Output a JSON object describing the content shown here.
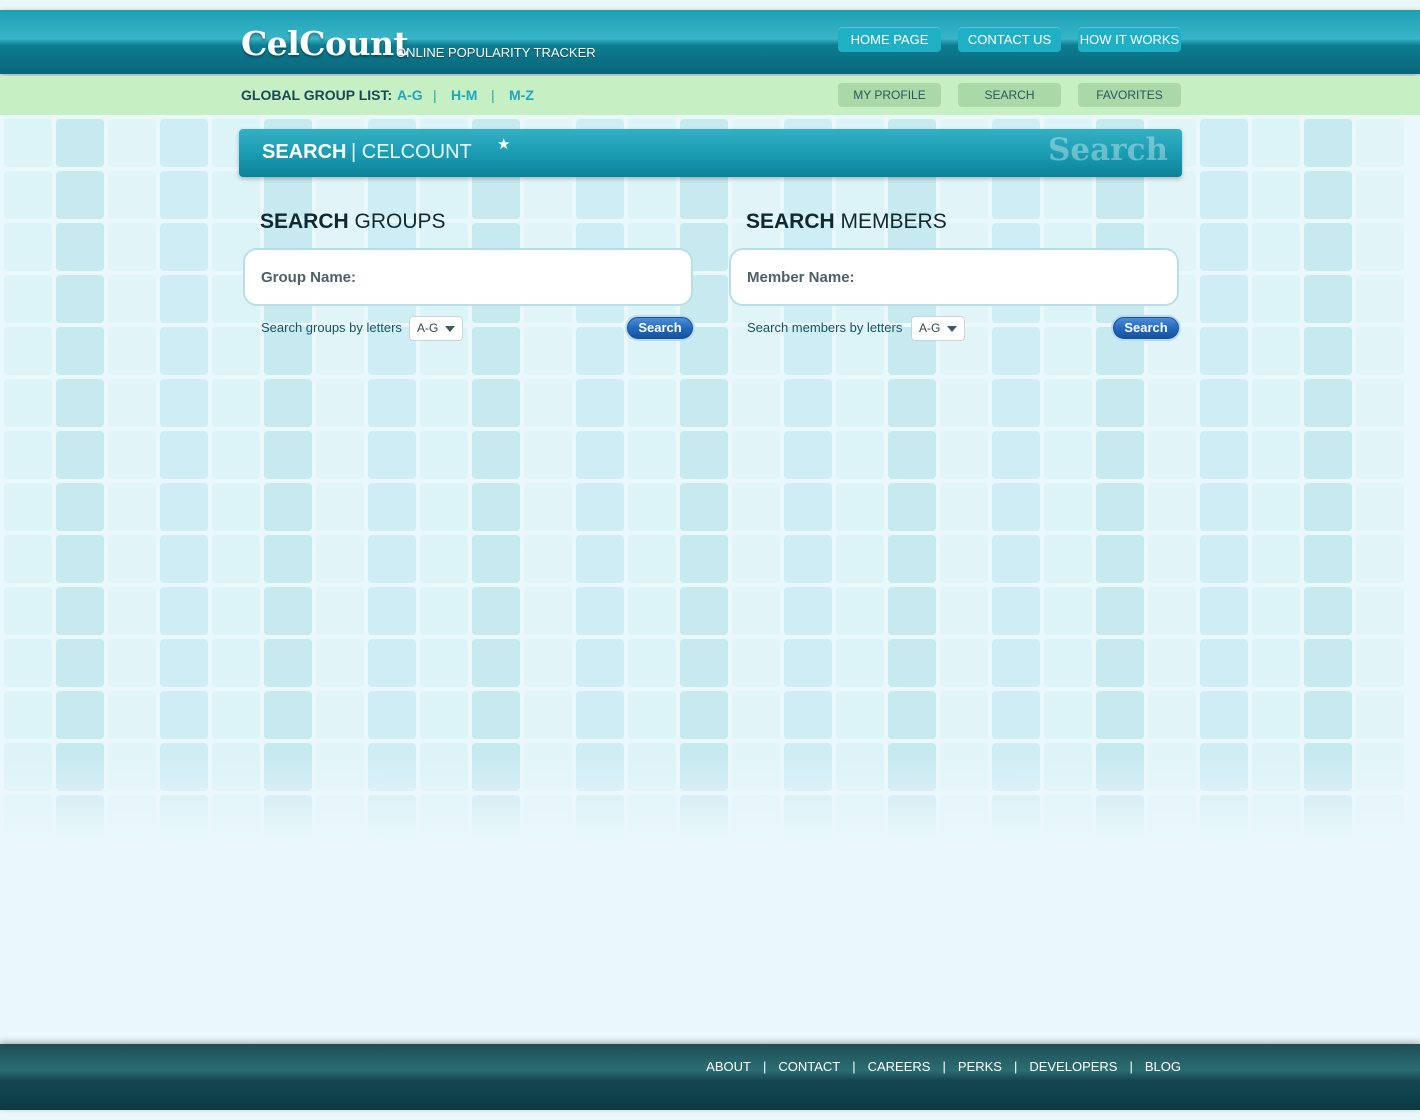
{
  "header": {
    "logo_text": "CelCount",
    "tagline": "ONLINE POPULARITY TRACKER",
    "nav": [
      "HOME PAGE",
      "CONTACT US",
      "HOW IT WORKS"
    ]
  },
  "subbar": {
    "group_list_label": "GLOBAL GROUP LIST:",
    "group_links": [
      "A-G",
      "H-M",
      "M-Z"
    ],
    "separator": "|",
    "nav": [
      "MY PROFILE",
      "SEARCH",
      "FAVORITES"
    ]
  },
  "banner": {
    "title": "SEARCH",
    "subtitle": "| CELCOUNT",
    "star": "★",
    "watermark": "Search"
  },
  "groups": {
    "heading_bold": "SEARCH",
    "heading_rest": " GROUPS",
    "input_placeholder": "Group Name:",
    "letters_label": "Search groups by letters",
    "letters_value": "A-G",
    "button_label": "Search"
  },
  "members": {
    "heading_bold": "SEARCH",
    "heading_rest": " MEMBERS",
    "input_placeholder": "Member Name:",
    "letters_label": "Search members by letters",
    "letters_value": "A-G",
    "button_label": "Search"
  },
  "footer": {
    "links": [
      "ABOUT",
      "CONTACT",
      "CAREERS",
      "PERKS",
      "DEVELOPERS",
      "BLOG"
    ],
    "separator": "|"
  }
}
